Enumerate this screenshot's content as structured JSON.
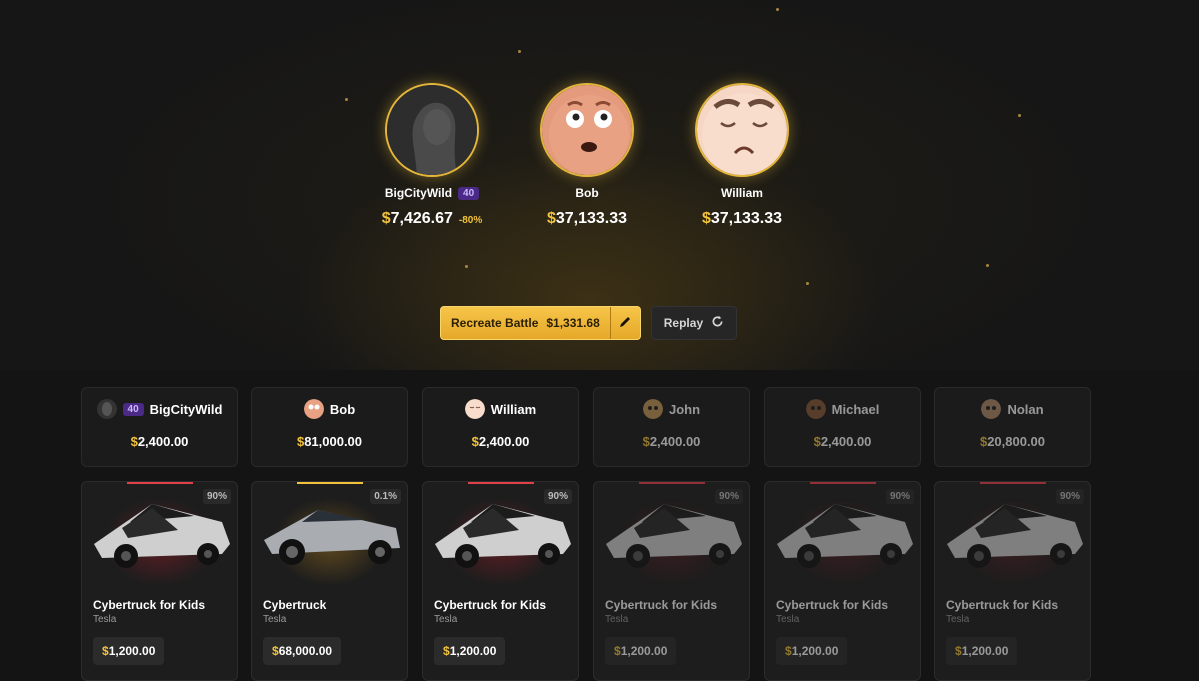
{
  "hero_players": [
    {
      "name": "BigCityWild",
      "level": "40",
      "value": "$7,426.67",
      "change": "-80%"
    },
    {
      "name": "Bob",
      "value": "$37,133.33"
    },
    {
      "name": "William",
      "value": "$37,133.33"
    }
  ],
  "actions": {
    "recreate_label": "Recreate Battle",
    "recreate_price": "$1,331.68",
    "replay_label": "Replay"
  },
  "player_cards": [
    {
      "name": "BigCityWild",
      "level": "40",
      "value": "$2,400.00",
      "active": true
    },
    {
      "name": "Bob",
      "value": "$81,000.00",
      "active": true
    },
    {
      "name": "William",
      "value": "$2,400.00",
      "active": true
    },
    {
      "name": "John",
      "value": "$2,400.00",
      "active": false
    },
    {
      "name": "Michael",
      "value": "$2,400.00",
      "active": false
    },
    {
      "name": "Nolan",
      "value": "$20,800.00",
      "active": false
    }
  ],
  "items": [
    {
      "name": "Cybertruck for Kids",
      "brand": "Tesla",
      "price": "$1,200.00",
      "odds": "90%",
      "rarity_color": "#e0404a"
    },
    {
      "name": "Cybertruck",
      "brand": "Tesla",
      "price": "$68,000.00",
      "odds": "0.1%",
      "rarity_color": "#f2c23c"
    },
    {
      "name": "Cybertruck for Kids",
      "brand": "Tesla",
      "price": "$1,200.00",
      "odds": "90%",
      "rarity_color": "#e0404a"
    },
    {
      "name": "Cybertruck for Kids",
      "brand": "Tesla",
      "price": "$1,200.00",
      "odds": "90%",
      "rarity_color": "#e0404a"
    },
    {
      "name": "Cybertruck for Kids",
      "brand": "Tesla",
      "price": "$1,200.00",
      "odds": "90%",
      "rarity_color": "#e0404a"
    },
    {
      "name": "Cybertruck for Kids",
      "brand": "Tesla",
      "price": "$1,200.00",
      "odds": "90%",
      "rarity_color": "#e0404a"
    }
  ],
  "colors": {
    "accent": "#f2c23c",
    "level_badge": "#4a2a86",
    "background": "#141414"
  }
}
